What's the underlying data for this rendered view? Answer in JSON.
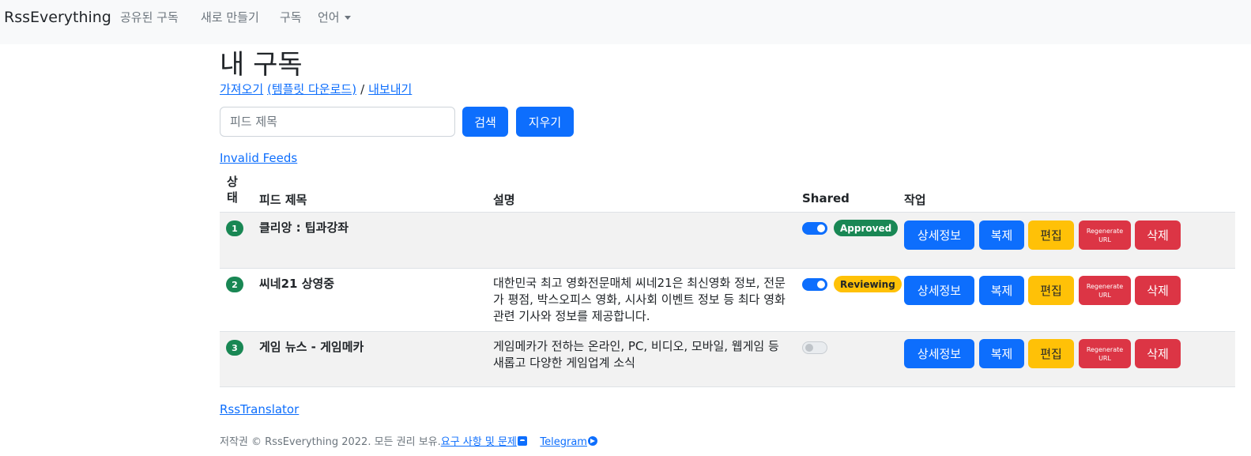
{
  "navbar": {
    "brand": "RssEverything",
    "links": [
      "공유된 구독",
      "새로 만들기",
      "구독",
      "언어"
    ]
  },
  "page": {
    "title": "내 구독",
    "import_link": "가져오기",
    "template_link": "(템플릿 다운로드)",
    "separator": "/",
    "export_link": "내보내기"
  },
  "search": {
    "placeholder": "피드 제목",
    "search_label": "검색",
    "clear_label": "지우기"
  },
  "invalid_feeds_link": "Invalid Feeds",
  "table": {
    "headers": {
      "status": "상\n태",
      "title": "피드 제목",
      "description": "설명",
      "shared": "Shared",
      "actions": "작업"
    },
    "action_labels": {
      "details": "상세정보",
      "duplicate": "복제",
      "edit": "편집",
      "regenerate": "Regenerate",
      "regenerate_sub": "URL",
      "delete": "삭제"
    },
    "rows": [
      {
        "index": "1",
        "title": "클리앙 : 팁과강좌",
        "description": "",
        "shared": true,
        "status_badge": "Approved"
      },
      {
        "index": "2",
        "title": "씨네21 상영중",
        "description": "대한민국 최고 영화전문매체 씨네21은 최신영화 정보, 전문가 평점, 박스오피스 영화, 시사회 이벤트 정보 등 최다 영화 관련 기사와 정보를 제공합니다.",
        "shared": true,
        "status_badge": "Reviewing"
      },
      {
        "index": "3",
        "title": "게임 뉴스 - 게임메카",
        "description": "게임메카가 전하는 온라인, PC, 비디오, 모바일, 웹게임 등 새롭고 다양한 게임업계 소식",
        "shared": false,
        "status_badge": ""
      }
    ]
  },
  "footer": {
    "translator_link": "RssTranslator",
    "copyright": "저작권 © RssEverything 2022. 모든 권리 보유.",
    "requests_link": "요구 사항 및 문제",
    "telegram_link": "Telegram"
  },
  "colors": {
    "primary": "#0d6efd",
    "success": "#198754",
    "warning": "#ffc107",
    "danger": "#dc3545"
  }
}
